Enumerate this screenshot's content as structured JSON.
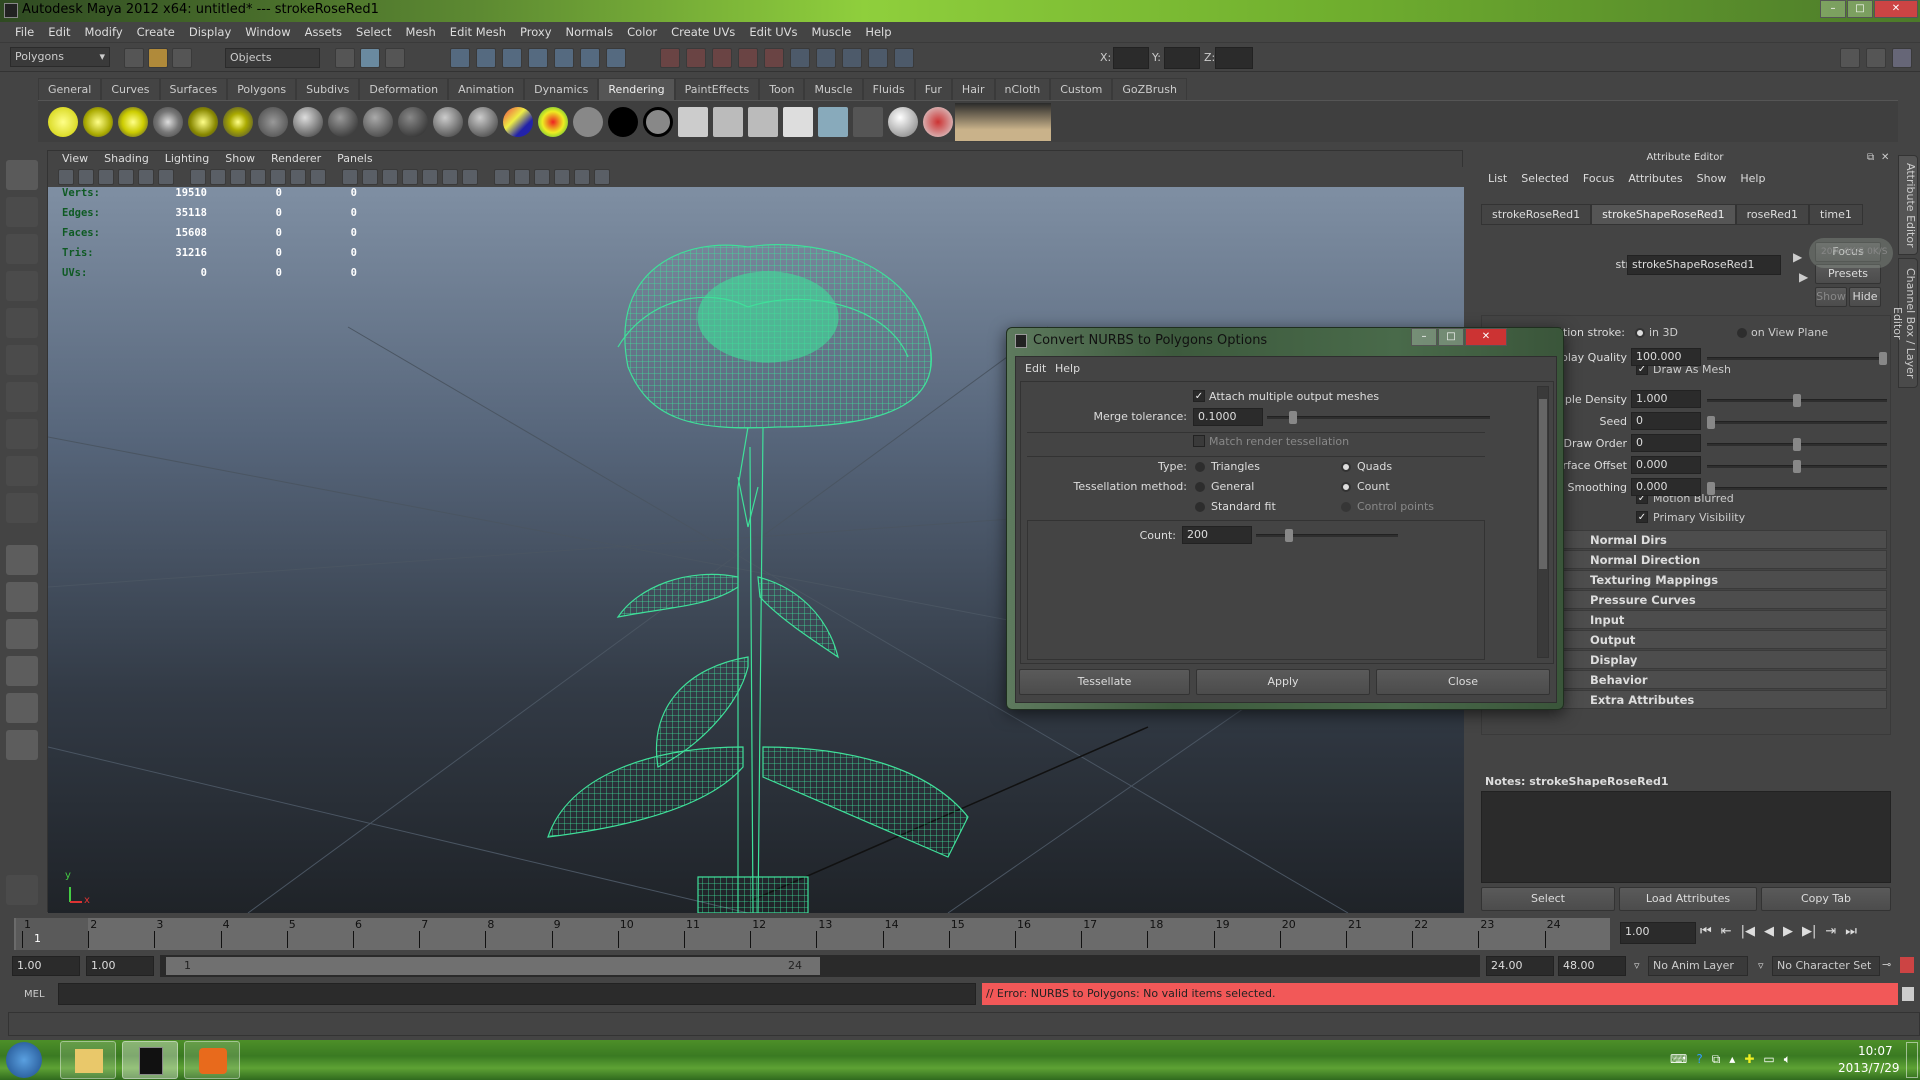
{
  "window": {
    "title": "Autodesk Maya 2012 x64: untitled*   ---   strokeRoseRed1"
  },
  "menubar": [
    "File",
    "Edit",
    "Modify",
    "Create",
    "Display",
    "Window",
    "Assets",
    "Select",
    "Mesh",
    "Edit Mesh",
    "Proxy",
    "Normals",
    "Color",
    "Create UVs",
    "Edit UVs",
    "Muscle",
    "Help"
  ],
  "statusline": {
    "menuset": "Polygons",
    "selection_mode": "Objects",
    "x_label": "X:",
    "y_label": "Y:",
    "z_label": "Z:"
  },
  "shelf": {
    "tabs": [
      "General",
      "Curves",
      "Surfaces",
      "Polygons",
      "Subdivs",
      "Deformation",
      "Animation",
      "Dynamics",
      "Rendering",
      "PaintEffects",
      "Toon",
      "Muscle",
      "Fluids",
      "Fur",
      "Hair",
      "nCloth",
      "Custom",
      "GoZBrush"
    ],
    "active_tab": "Rendering"
  },
  "viewport": {
    "menu": [
      "View",
      "Shading",
      "Lighting",
      "Show",
      "Renderer",
      "Panels"
    ],
    "hud": [
      {
        "label": "Verts:",
        "values": [
          "19510",
          "0",
          "0"
        ]
      },
      {
        "label": "Edges:",
        "values": [
          "35118",
          "0",
          "0"
        ]
      },
      {
        "label": "Faces:",
        "values": [
          "15608",
          "0",
          "0"
        ]
      },
      {
        "label": "Tris:",
        "values": [
          "31216",
          "0",
          "0"
        ]
      },
      {
        "label": "UVs:",
        "values": [
          "0",
          "0",
          "0"
        ]
      }
    ],
    "axis_y": "y",
    "axis_x": "x",
    "wire_color": "#3fe09a"
  },
  "dialog": {
    "title": "Convert NURBS to Polygons Options",
    "menu": [
      "Edit",
      "Help"
    ],
    "attach_label": "Attach multiple output meshes",
    "attach_checked": true,
    "merge_label": "Merge tolerance:",
    "merge_value": "0.1000",
    "match_label": "Match render tessellation",
    "match_checked": false,
    "type_label": "Type:",
    "type_options": [
      "Triangles",
      "Quads"
    ],
    "type_selected": "Quads",
    "tess_label": "Tessellation method:",
    "tess_options": [
      "General",
      "Count",
      "Standard fit",
      "Control points"
    ],
    "tess_selected": "Count",
    "count_label": "Count:",
    "count_value": "200",
    "buttons": [
      "Tessellate",
      "Apply",
      "Close"
    ]
  },
  "attribute_editor": {
    "title": "Attribute Editor",
    "menu": [
      "List",
      "Selected",
      "Focus",
      "Attributes",
      "Show",
      "Help"
    ],
    "tabs": [
      "strokeRoseRed1",
      "strokeShapeRoseRed1",
      "roseRed1",
      "time1"
    ],
    "active_tab": "strokeShapeRoseRed1",
    "stroke_label": "stroke:",
    "stroke_value": "strokeShapeRoseRed1",
    "focus_btn": "Focus",
    "presets_btn": "Presets",
    "show_btn": "Show",
    "hide_btn": "Hide",
    "overlay_percent": "20%",
    "overlay_rate_up": "0K/S",
    "overlay_rate_down": "0K/S",
    "position_label": "Position stroke:",
    "position_options": [
      "in 3D",
      "on View Plane"
    ],
    "fields": [
      {
        "label": "Display Quality",
        "value": "100.000",
        "level": 1.0
      },
      {
        "label": "Sample Density",
        "value": "1.000",
        "level": 0.5
      },
      {
        "label": "Seed",
        "value": "0",
        "level": 0.0
      },
      {
        "label": "Draw Order",
        "value": "0",
        "level": 0.5
      },
      {
        "label": "Surface Offset",
        "value": "0.000",
        "level": 0.5
      },
      {
        "label": "Smoothing",
        "value": "0.000",
        "level": 0.0
      }
    ],
    "draw_as_mesh": "Draw As Mesh",
    "motion_blurred": "Motion Blurred",
    "primary_visibility": "Primary Visibility",
    "sections": [
      "Normal Dirs",
      "Normal Direction",
      "Texturing Mappings",
      "Pressure Curves",
      "Input",
      "Output",
      "Display",
      "Behavior",
      "Extra Attributes"
    ],
    "notes_label": "Notes:  strokeShapeRoseRed1",
    "buttons": [
      "Select",
      "Load Attributes",
      "Copy Tab"
    ],
    "side_tabs": [
      "Attribute Editor",
      "Channel Box / Layer Editor"
    ]
  },
  "timeline": {
    "ticks": [
      "1",
      "2",
      "3",
      "4",
      "5",
      "6",
      "7",
      "8",
      "9",
      "10",
      "11",
      "12",
      "13",
      "14",
      "15",
      "16",
      "17",
      "18",
      "19",
      "20",
      "21",
      "22",
      "23",
      "24"
    ],
    "current": "1",
    "current_field": "1.00"
  },
  "range": {
    "start": "1.00",
    "playback_start": "1.00",
    "slider_start": "1",
    "slider_end": "24",
    "playback_end": "24.00",
    "end": "48.00",
    "anim_layer": "No Anim Layer",
    "character_set": "No Character Set"
  },
  "command": {
    "label": "MEL",
    "result": "// Error: NURBS to Polygons: No valid items selected.",
    "error_color": "#f25858"
  },
  "taskbar": {
    "time": "10:07",
    "date": "2013/7/29"
  }
}
